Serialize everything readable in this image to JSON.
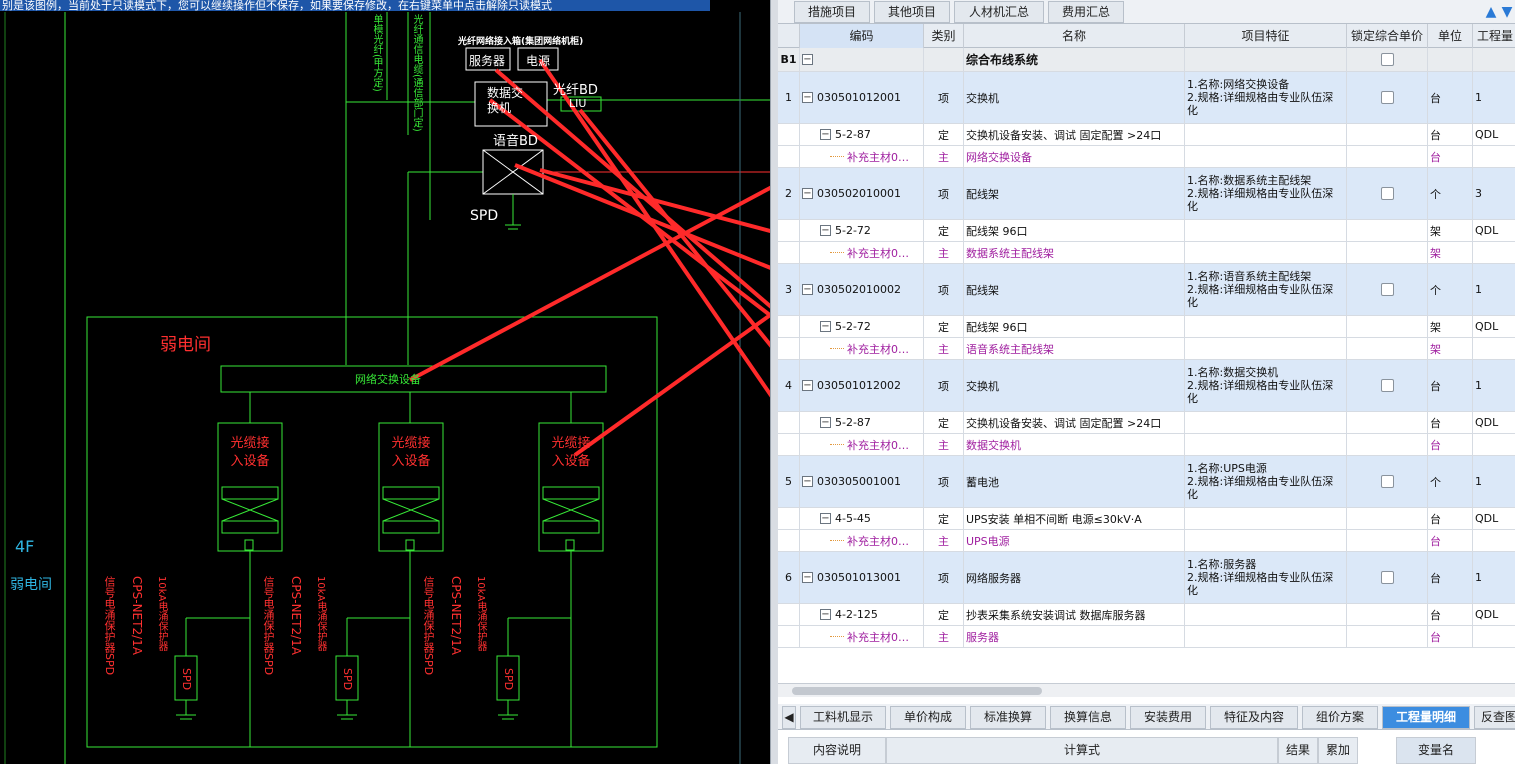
{
  "cad": {
    "top_note": "别是该图例，当前处于只读模式下，您可以继续操作但不保存，如果要保存修改，在右键菜单中点击解除只读模式",
    "labels": {
      "group_title": "光纤网络接入箱(集团网络机柜)",
      "server": "服务器",
      "power": "电源",
      "data_switch": "数据交换机",
      "fiber_bd": "光纤BD",
      "liu": "LIU",
      "voice_bd": "语音BD",
      "spd": "SPD",
      "riser_1": "单模光纤(甲方定)",
      "riser_2": "光纤通信电缆(通信部门定)",
      "weak_room": "弱电间",
      "net_device": "网络交换设备",
      "fiber_access": "光缆接入设备",
      "floor": "4F",
      "floor_room": "弱电间",
      "spd_note_1": "信号电涌保护器SPD",
      "spd_note_2": "CPS-NET2/1A",
      "spd_note_3": "10kA电涌保护器"
    }
  },
  "top_tabs": [
    "措施项目",
    "其他项目",
    "人材机汇总",
    "费用汇总"
  ],
  "table": {
    "headers": [
      "编码",
      "类别",
      "名称",
      "项目特征",
      "锁定综合单价",
      "单位",
      "工程量"
    ],
    "section": {
      "label": "B1",
      "name": "综合布线系统"
    },
    "rows": [
      {
        "type": "qd",
        "idx": "1",
        "code": "030501012001",
        "cat": "项",
        "name": "交换机",
        "feat": [
          "1.名称:网络交换设备",
          "2.规格:详细规格由专业队伍深化"
        ],
        "unit": "台",
        "qty": "1"
      },
      {
        "type": "de",
        "code": "5-2-87",
        "cat": "定",
        "name": "交换机设备安装、调试 固定配置 >24口",
        "unit": "台",
        "qty": "QDL"
      },
      {
        "type": "zc",
        "code": "补充主材0…",
        "cat": "主",
        "name": "网络交换设备",
        "unit": "台",
        "qty": ""
      },
      {
        "type": "qd",
        "idx": "2",
        "code": "030502010001",
        "cat": "项",
        "name": "配线架",
        "feat": [
          "1.名称:数据系统主配线架",
          "2.规格:详细规格由专业队伍深化"
        ],
        "unit": "个",
        "qty": "3"
      },
      {
        "type": "de",
        "code": "5-2-72",
        "cat": "定",
        "name": "配线架 96口",
        "unit": "架",
        "qty": "QDL"
      },
      {
        "type": "zc",
        "code": "补充主材0…",
        "cat": "主",
        "name": "数据系统主配线架",
        "unit": "架",
        "qty": ""
      },
      {
        "type": "qd",
        "idx": "3",
        "code": "030502010002",
        "cat": "项",
        "name": "配线架",
        "feat": [
          "1.名称:语音系统主配线架",
          "2.规格:详细规格由专业队伍深化"
        ],
        "unit": "个",
        "qty": "1"
      },
      {
        "type": "de",
        "code": "5-2-72",
        "cat": "定",
        "name": "配线架 96口",
        "unit": "架",
        "qty": "QDL"
      },
      {
        "type": "zc",
        "code": "补充主材0…",
        "cat": "主",
        "name": "语音系统主配线架",
        "unit": "架",
        "qty": ""
      },
      {
        "type": "qd",
        "idx": "4",
        "code": "030501012002",
        "cat": "项",
        "name": "交换机",
        "feat": [
          "1.名称:数据交换机",
          "2.规格:详细规格由专业队伍深化"
        ],
        "unit": "台",
        "qty": "1"
      },
      {
        "type": "de",
        "code": "5-2-87",
        "cat": "定",
        "name": "交换机设备安装、调试 固定配置 >24口",
        "unit": "台",
        "qty": "QDL"
      },
      {
        "type": "zc",
        "code": "补充主材0…",
        "cat": "主",
        "name": "数据交换机",
        "unit": "台",
        "qty": ""
      },
      {
        "type": "qd",
        "idx": "5",
        "code": "030305001001",
        "cat": "项",
        "name": "蓄电池",
        "feat": [
          "1.名称:UPS电源",
          "2.规格:详细规格由专业队伍深化"
        ],
        "unit": "个",
        "qty": "1"
      },
      {
        "type": "de",
        "code": "4-5-45",
        "cat": "定",
        "name": "UPS安装 单相不间断 电源≤30kV·A",
        "unit": "台",
        "qty": "QDL"
      },
      {
        "type": "zc",
        "code": "补充主材0…",
        "cat": "主",
        "name": "UPS电源",
        "unit": "台",
        "qty": ""
      },
      {
        "type": "qd",
        "idx": "6",
        "code": "030501013001",
        "cat": "项",
        "name": "网络服务器",
        "feat": [
          "1.名称:服务器",
          "2.规格:详细规格由专业队伍深化"
        ],
        "unit": "台",
        "qty": "1"
      },
      {
        "type": "de",
        "code": "4-2-125",
        "cat": "定",
        "name": "抄表采集系统安装调试 数据库服务器",
        "unit": "台",
        "qty": "QDL"
      },
      {
        "type": "zc",
        "code": "补充主材0…",
        "cat": "主",
        "name": "服务器",
        "unit": "台",
        "qty": ""
      }
    ]
  },
  "bottom_tabs": [
    "工料机显示",
    "单价构成",
    "标准换算",
    "换算信息",
    "安装费用",
    "特征及内容",
    "组价方案",
    "工程量明细",
    "反查图"
  ],
  "active_bottom_tab": "工程量明细",
  "sub_headers": [
    "内容说明",
    "计算式",
    "结果",
    "累加"
  ],
  "var_header": "变量名",
  "colors": {
    "arrow": "#ff2a2a",
    "cad_green": "#37e837",
    "cad_red": "#ff3030",
    "active_tab": "#3c8de0",
    "qd_row": "#dbe8f8",
    "purple": "#a020a0"
  }
}
